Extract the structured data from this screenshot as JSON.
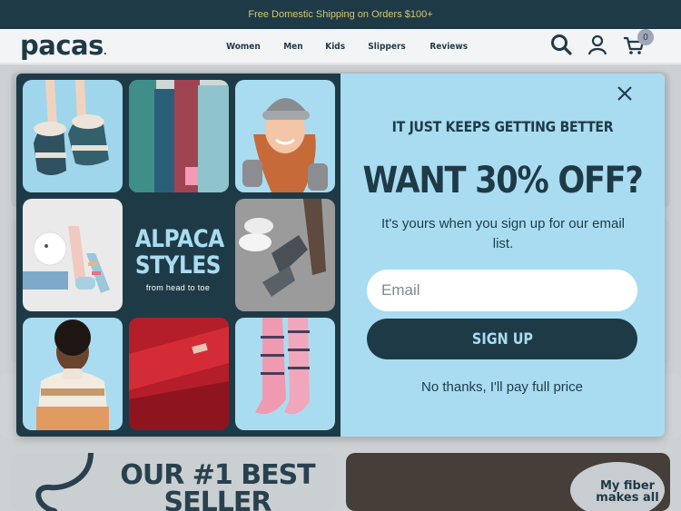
{
  "announcement": "Free Domestic Shipping on Orders $100+",
  "header": {
    "logo": "pacas",
    "nav": [
      "Women",
      "Men",
      "Kids",
      "Slippers",
      "Reviews"
    ],
    "icons": [
      "search-icon",
      "account-icon",
      "cart-icon"
    ],
    "cart_count": "0"
  },
  "background": {
    "bestseller": "OUR #1 BEST SELLER",
    "fiber": "My fiber makes all"
  },
  "modal": {
    "collage_title": "ALPACA STYLES",
    "collage_subtitle": "from head to toe",
    "kicker": "IT JUST KEEPS GETTING BETTER",
    "headline": "WANT 30% OFF?",
    "subtext": "It's yours when you sign up for our email list.",
    "email_placeholder": "Email",
    "signup_label": "SIGN UP",
    "decline_label": "No thanks, I'll pay full price"
  },
  "colors": {
    "brand_navy": "#1f3a47",
    "accent_blue": "#a9dcf0",
    "announcement_text": "#d2c96a"
  }
}
